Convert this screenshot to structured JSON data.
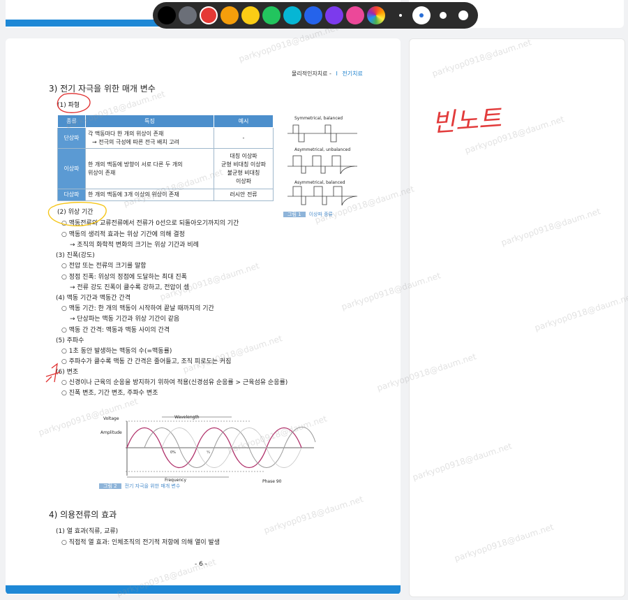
{
  "toolbar": {
    "colors": [
      "#000000",
      "#6b6f78",
      "#e53935",
      "#f59e0b",
      "#facc15",
      "#22c55e",
      "#06b6d4",
      "#2563eb",
      "#7c3aed",
      "#ec4899"
    ],
    "selected_color": "#e53935",
    "selected_size_index": 1
  },
  "page": {
    "header_left": "물리적인자치료 - ",
    "header_sep": "I",
    "header_right": "전기치료",
    "section3_title": "3) 전기 자극을 위한 매개 변수",
    "sub1": "(1) 파형",
    "table": {
      "headers": [
        "종류",
        "특징",
        "예시"
      ],
      "rows": [
        {
          "type": "단상파",
          "feature1": "각 맥동마다 한 개의 위상이 존재",
          "feature2": "→ 전극의 극성에 따른 전극 배치 고려",
          "example": "-"
        },
        {
          "type": "이상파",
          "feature1": "한 개의 맥동에 방향이 서로 다른 두 개의",
          "feature2": "위상이 존재",
          "example1": "대칭 이상파",
          "example2": "균형 비대칭 이상파",
          "example3": "불균형 비대칭",
          "example4": "이상파"
        },
        {
          "type": "다상파",
          "feature1": "한 개의 맥동에 3개 이상의 위상이 존재",
          "example": "러시안 전류"
        }
      ]
    },
    "fig1": {
      "label1": "Symmetrical, balanced",
      "label2": "Asymmetrical, unbalanced",
      "label3": "Asymmetrical, balanced",
      "caption_num": "그림 1",
      "caption": "이상파 종류"
    },
    "sub2": "(2) 위상 기간",
    "sub2_items": [
      "○ 맥동전류와 교류전류에서 전류가 0선으로 되돌아오기까지의 기간",
      "○ 맥동의 생리적 효과는 위상 기간에 의해 결정",
      "→ 조직의 화학적 변화의 크기는 위상 기간과 비례"
    ],
    "sub3": "(3) 진폭(강도)",
    "sub3_items": [
      "○ 전압 또는 전류의 크기를 말함",
      "○ 정점 진폭: 위상의 정점에 도달하는 최대 진폭",
      "→ 전류 강도 진폭이 클수록 강하고, 전압이 셈"
    ],
    "sub4": "(4) 맥동 기간과 맥동간 간격",
    "sub4_items": [
      "○ 맥동 기간: 한 개의 맥동이 시작하여 끝날 때까지의 기간",
      "→ 단상파는 맥동 기간과 위상 기간이 같음",
      "○ 맥동 간 간격: 맥동과 맥동 사이의 간격"
    ],
    "sub5": "(5) 주파수",
    "sub5_items": [
      "○ 1초 동안 발생하는 맥동의 수(=맥동률)",
      "○ 주파수가 클수록 맥동 간 간격은 줄어들고, 조직 피로도는 커짐"
    ],
    "sub6": "(6) 변조",
    "sub6_items": [
      "○ 신경이나 근육의 순응을 방지하기 위하여 적용(신경섬유 순응률 > 근육섬유 순응률)",
      "○ 진폭 변조, 기간 변조, 주파수 변조"
    ],
    "fig2": {
      "voltage": "Voltage",
      "wavelength": "Wavelength",
      "amplitude": "Amplitude",
      "zero": "0%",
      "t1": "¼",
      "frequency": "Frequency",
      "phase": "Phase 90",
      "caption_num": "그림 2",
      "caption": "전기 자극을 위한 매개 변수"
    },
    "section4_title": "4) 의용전류의 효과",
    "sub4_1": "(1) 열 효과(직류, 교류)",
    "sub4_1_items": [
      "○ 직접적 열 효과: 인체조직의 전기적 저항에 의해 열이 발생"
    ],
    "page_number": "- 6 -"
  },
  "note": {
    "handwriting": "빈노트"
  },
  "watermark": "parkyop0918@daum.net"
}
